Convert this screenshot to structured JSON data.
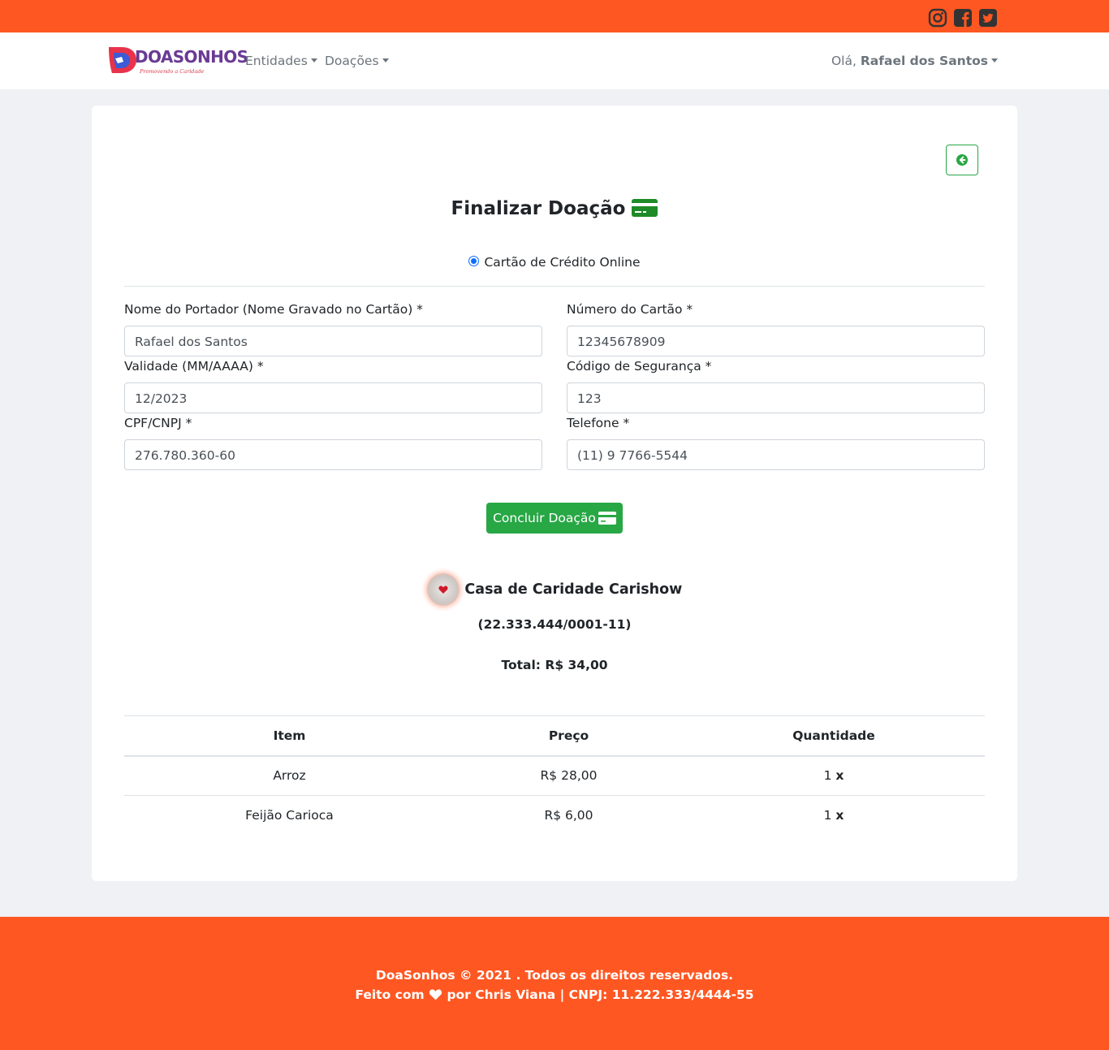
{
  "topbar": {
    "social": [
      "instagram-icon",
      "facebook-icon",
      "twitter-icon"
    ],
    "color": "#ff5722"
  },
  "navbar": {
    "logo_text": "DOASONHOS",
    "logo_tagline": "Promovendo a Caridade",
    "menu": [
      {
        "label": "Entidades"
      },
      {
        "label": "Doações"
      }
    ],
    "greeting": "Olá,",
    "user_name": "Rafael dos Santos"
  },
  "page": {
    "title": "Finalizar Doação",
    "payment_option": "Cartão de Crédito Online"
  },
  "form": {
    "holder_label": "Nome do Portador (Nome Gravado no Cartão) *",
    "holder_value": "Rafael dos Santos",
    "card_number_label": "Número do Cartão *",
    "card_number_value": "12345678909",
    "expiry_label": "Validade (MM/AAAA) *",
    "expiry_value": "12/2023",
    "cvv_label": "Código de Segurança *",
    "cvv_value": "123",
    "doc_label": "CPF/CNPJ *",
    "doc_value": "276.780.360-60",
    "phone_label": "Telefone *",
    "phone_value": "(11) 9 7766-5544",
    "submit_label": "Concluir Doação"
  },
  "entity": {
    "name": "Casa de Caridade Carishow",
    "doc": "(22.333.444/0001-11)",
    "total": "Total: R$ 34,00"
  },
  "table": {
    "headers": [
      "Item",
      "Preço",
      "Quantidade"
    ],
    "rows": [
      {
        "item": "Arroz",
        "price": "R$ 28,00",
        "qty": "1",
        "qty_suffix": "x"
      },
      {
        "item": "Feijão Carioca",
        "price": "R$ 6,00",
        "qty": "1",
        "qty_suffix": "x"
      }
    ]
  },
  "footer": {
    "line1": "DoaSonhos © 2021 . Todos os direitos reservados.",
    "made_with": "Feito com",
    "by": "por Chris Viana | CNPJ: 11.222.333/4444-55"
  },
  "colors": {
    "accent_orange": "#ff5722",
    "success_green": "#28a745",
    "radio_blue": "#0d6efd",
    "page_bg": "#f0f1f5"
  }
}
